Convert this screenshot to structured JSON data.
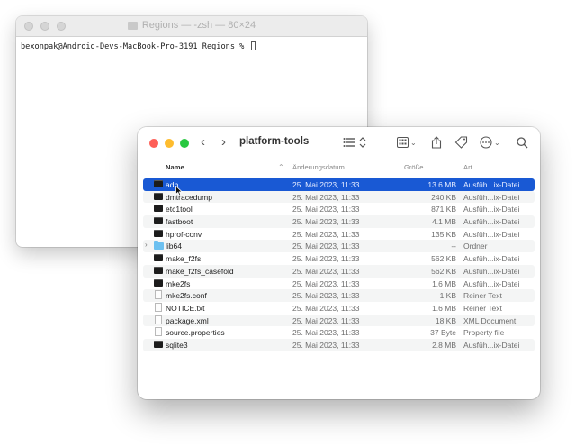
{
  "terminal": {
    "title": "Regions — -zsh — 80×24",
    "prompt": "bexonpak@Android-Devs-MacBook-Pro-3191 Regions % "
  },
  "finder": {
    "title": "platform-tools",
    "columns": {
      "name": "Name",
      "date": "Änderungsdatum",
      "size": "Größe",
      "kind": "Art"
    },
    "files": [
      {
        "name": "adb",
        "date": "25. Mai 2023, 11:33",
        "size": "13.6 MB",
        "kind": "Ausfüh...ix-Datei",
        "icon": "exec-icon",
        "selected": true
      },
      {
        "name": "dmtracedump",
        "date": "25. Mai 2023, 11:33",
        "size": "240 KB",
        "kind": "Ausfüh...ix-Datei",
        "icon": "exec-icon"
      },
      {
        "name": "etc1tool",
        "date": "25. Mai 2023, 11:33",
        "size": "871 KB",
        "kind": "Ausfüh...ix-Datei",
        "icon": "exec-icon"
      },
      {
        "name": "fastboot",
        "date": "25. Mai 2023, 11:33",
        "size": "4.1 MB",
        "kind": "Ausfüh...ix-Datei",
        "icon": "exec-icon"
      },
      {
        "name": "hprof-conv",
        "date": "25. Mai 2023, 11:33",
        "size": "135 KB",
        "kind": "Ausfüh...ix-Datei",
        "icon": "exec-icon"
      },
      {
        "name": "lib64",
        "date": "25. Mai 2023, 11:33",
        "size": "--",
        "kind": "Ordner",
        "icon": "folder-icon"
      },
      {
        "name": "make_f2fs",
        "date": "25. Mai 2023, 11:33",
        "size": "562 KB",
        "kind": "Ausfüh...ix-Datei",
        "icon": "exec-icon"
      },
      {
        "name": "make_f2fs_casefold",
        "date": "25. Mai 2023, 11:33",
        "size": "562 KB",
        "kind": "Ausfüh...ix-Datei",
        "icon": "exec-icon"
      },
      {
        "name": "mke2fs",
        "date": "25. Mai 2023, 11:33",
        "size": "1.6 MB",
        "kind": "Ausfüh...ix-Datei",
        "icon": "exec-icon"
      },
      {
        "name": "mke2fs.conf",
        "date": "25. Mai 2023, 11:33",
        "size": "1 KB",
        "kind": "Reiner Text",
        "icon": "document-icon"
      },
      {
        "name": "NOTICE.txt",
        "date": "25. Mai 2023, 11:33",
        "size": "1.6 MB",
        "kind": "Reiner Text",
        "icon": "document-icon"
      },
      {
        "name": "package.xml",
        "date": "25. Mai 2023, 11:33",
        "size": "18 KB",
        "kind": "XML Document",
        "icon": "document-icon"
      },
      {
        "name": "source.properties",
        "date": "25. Mai 2023, 11:33",
        "size": "37 Byte",
        "kind": "Property file",
        "icon": "document-icon"
      },
      {
        "name": "sqlite3",
        "date": "25. Mai 2023, 11:33",
        "size": "2.8 MB",
        "kind": "Ausfüh...ix-Datei",
        "icon": "exec-icon"
      }
    ]
  }
}
